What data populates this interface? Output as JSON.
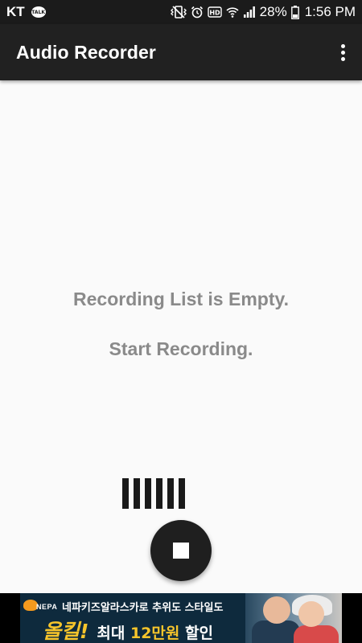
{
  "status_bar": {
    "carrier": "KT",
    "talk_badge": "TALK",
    "battery_percent": "28%",
    "time": "1:56 PM",
    "icons": [
      "vibrate-icon",
      "alarm-icon",
      "hd-icon",
      "wifi-icon",
      "signal-icon",
      "battery-icon"
    ]
  },
  "app_bar": {
    "title": "Audio Recorder",
    "overflow_icon": "more-vert-icon"
  },
  "empty_state": {
    "line1": "Recording List is Empty.",
    "line2": "Start Recording."
  },
  "recorder": {
    "level_bars": 6,
    "stop_icon": "stop-icon"
  },
  "ad": {
    "brand": "NEPA",
    "headline": "네파키즈알라스카로 추위도 스타일도",
    "big_text": "올킬!",
    "offer_prefix": "최대 ",
    "offer_highlight": "12만원",
    "offer_suffix": " 할인"
  },
  "colors": {
    "status_bar_bg": "#1b1b1b",
    "app_bar_bg": "#212121",
    "background": "#fafafa",
    "empty_text": "#8a8a8a",
    "fab": "#1f1f1f",
    "ad_highlight": "#f7c52b"
  }
}
